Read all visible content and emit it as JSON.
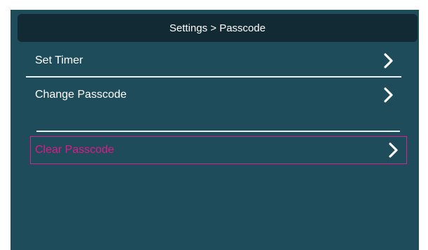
{
  "header": {
    "title": "Settings > Passcode"
  },
  "menu": {
    "items": [
      {
        "label": "Set Timer",
        "icon": "chevron-right-icon"
      },
      {
        "label": "Change Passcode",
        "icon": "chevron-right-icon"
      },
      {
        "label": "Clear Passcode",
        "icon": "chevron-right-icon",
        "highlighted": true
      }
    ]
  },
  "colors": {
    "background": "#1f4c5a",
    "title_bar": "#122a33",
    "text": "#ffffff",
    "highlight": "#e0188a"
  }
}
